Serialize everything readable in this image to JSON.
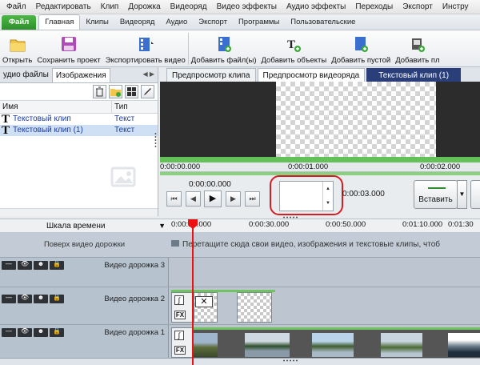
{
  "menu": [
    "Файл",
    "Редактировать",
    "Клип",
    "Дорожка",
    "Видеоряд",
    "Видео эффекты",
    "Аудио эффекты",
    "Переходы",
    "Экспорт",
    "Инстру"
  ],
  "ribbon_tabs": [
    "Файл",
    "Главная",
    "Клипы",
    "Видеоряд",
    "Аудио",
    "Экспорт",
    "Программы",
    "Пользовательские"
  ],
  "toolbar": {
    "open": "Открыть",
    "save_project": "Сохранить проект",
    "export_video": "Экспортировать видео",
    "add_files": "Добавить файл(ы)",
    "add_objects": "Добавить объекты",
    "add_empty": "Добавить пустой",
    "add_more": "Добавить пл"
  },
  "left_panel": {
    "tab_audio": "удио файлы",
    "tab_images": "Изображения",
    "col_name": "Имя",
    "col_type": "Тип",
    "rows": [
      {
        "name": "Текстовый клип",
        "type": "Текст"
      },
      {
        "name": "Текстовый клип (1)",
        "type": "Текст"
      }
    ]
  },
  "preview": {
    "tab_clip": "Предпросмотр клипа",
    "tab_sequence": "Предпросмотр видеоряда",
    "tab_text_clip": "Текстовый клип (1)",
    "ruler": [
      "0:00:00.000",
      "0:00:01.000",
      "0:00:02.000"
    ],
    "current_time": "0:00:00.000",
    "duration": "0:00:03.000",
    "insert_label": "Вставить"
  },
  "timeline": {
    "scale_label": "Шкала времени",
    "ruler": [
      "0:00:10.000",
      "0:00:30.000",
      "0:00:50.000",
      "0:01:10.000",
      "0:01:30"
    ],
    "overlay_label": "Поверх видео дорожки",
    "overlay_hint": "Перетащите сюда свои видео, изображения и текстовые клипы, чтоб",
    "tracks": [
      "Видео дорожка 3",
      "Видео дорожка 2",
      "Видео дорожка 1"
    ],
    "fx_label": "FX"
  },
  "colors": {
    "accent_green": "#4cb845",
    "text_clip_tab": "#2a3f7a",
    "playhead": "#e11111",
    "highlight_ring": "#d51d23"
  }
}
